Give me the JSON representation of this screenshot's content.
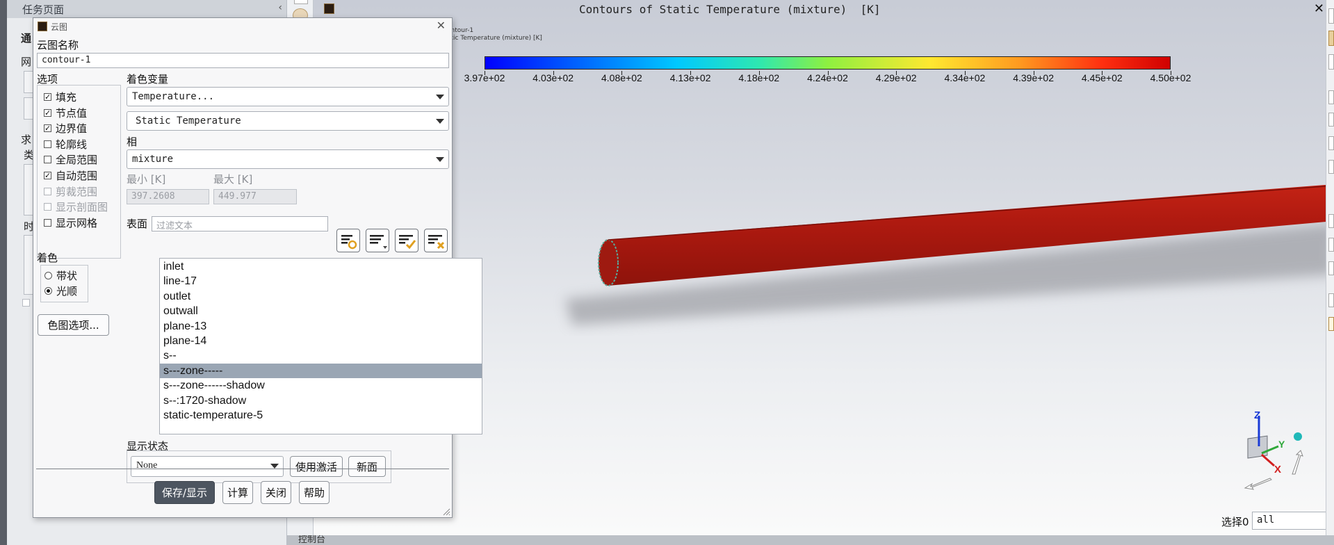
{
  "task_page": {
    "title": "任务页面",
    "ghost_labels": [
      "通",
      "网",
      "求",
      "类",
      "时"
    ]
  },
  "viewport": {
    "title": "Contours of Static Temperature (mixture)  [K]",
    "small_line1": "ontour-1",
    "small_line2": "atic Temperature (mixture) [K]",
    "close_symbol": "✕",
    "colorbar_labels": [
      "3.97e+02",
      "4.03e+02",
      "4.08e+02",
      "4.13e+02",
      "4.18e+02",
      "4.24e+02",
      "4.29e+02",
      "4.34e+02",
      "4.39e+02",
      "4.45e+02",
      "4.50e+02"
    ],
    "axis_labels": {
      "x": "X",
      "y": "Y",
      "z": "Z"
    },
    "select_label": "选择0",
    "select_value": "all",
    "console_label": "控制台"
  },
  "dialog": {
    "title": "云图",
    "name_label": "云图名称",
    "name_value": "contour-1",
    "options_label": "选项",
    "options": [
      {
        "label": "填充",
        "checked": true,
        "enabled": true
      },
      {
        "label": "节点值",
        "checked": true,
        "enabled": true
      },
      {
        "label": "边界值",
        "checked": true,
        "enabled": true
      },
      {
        "label": "轮廓线",
        "checked": false,
        "enabled": true
      },
      {
        "label": "全局范围",
        "checked": false,
        "enabled": true
      },
      {
        "label": "自动范围",
        "checked": true,
        "enabled": true
      },
      {
        "label": "剪裁范围",
        "checked": false,
        "enabled": false
      },
      {
        "label": "显示剖面图",
        "checked": false,
        "enabled": false
      },
      {
        "label": "显示网格",
        "checked": false,
        "enabled": true
      }
    ],
    "coloring_label": "着色",
    "coloring": [
      {
        "label": "带状",
        "selected": false
      },
      {
        "label": "光顺",
        "selected": true
      }
    ],
    "colormap_button": "色图选项...",
    "color_var_label": "着色变量",
    "color_var_category": "Temperature...",
    "color_var_field": "Static Temperature",
    "phase_label": "相",
    "phase_value": "mixture",
    "min_label": "最小 [K]",
    "min_value": "397.2608",
    "max_label": "最大 [K]",
    "max_value": "449.977",
    "surface_label": "表面",
    "surface_filter_placeholder": "过滤文本",
    "surfaces": [
      {
        "name": "inlet",
        "selected": false
      },
      {
        "name": "line-17",
        "selected": false
      },
      {
        "name": "outlet",
        "selected": false
      },
      {
        "name": "outwall",
        "selected": false
      },
      {
        "name": "plane-13",
        "selected": false
      },
      {
        "name": "plane-14",
        "selected": false
      },
      {
        "name": "s--",
        "selected": false
      },
      {
        "name": "s---zone-----",
        "selected": true
      },
      {
        "name": "s---zone------shadow",
        "selected": false
      },
      {
        "name": "s--:1720-shadow",
        "selected": false
      },
      {
        "name": "static-temperature-5",
        "selected": false
      }
    ],
    "display_state_label": "显示状态",
    "display_state_value": "None",
    "use_active_button": "使用激活",
    "new_button": "新面",
    "buttons": {
      "save_display": "保存/显示",
      "compute": "计算",
      "close": "关闭",
      "help": "帮助"
    }
  },
  "colors": {
    "pipe_red": "#b01a10",
    "primary_button": "#4d5560",
    "selection": "#9aa6b4"
  }
}
